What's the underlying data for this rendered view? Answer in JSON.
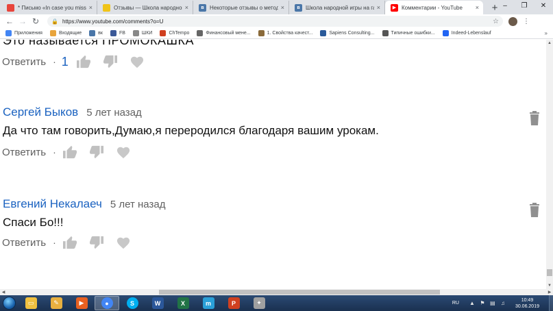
{
  "tabs": [
    {
      "title": "* Письмо «In case you missed it»",
      "icon": "mail-icon",
      "color": "#e8453c",
      "active": false
    },
    {
      "title": "Отзывы — Школа народной игры",
      "icon": "tab-page-icon",
      "color": "#f0c419",
      "active": false
    },
    {
      "title": "Некоторые отзывы о методике",
      "icon": "vk-icon",
      "color": "#4a76a8",
      "active": false
    },
    {
      "title": "Школа народной игры на гармони",
      "icon": "vk-icon",
      "color": "#4a76a8",
      "active": false
    },
    {
      "title": "Комментарии - YouTube",
      "icon": "youtube-icon",
      "color": "#ff0000",
      "active": true
    }
  ],
  "address": {
    "url": "https://www.youtube.com/comments?o=U"
  },
  "bookmarks": [
    {
      "label": "Приложения",
      "icon": "apps-icon",
      "color": "#4285f4"
    },
    {
      "label": "Входящие",
      "icon": "mail-icon",
      "color": "#e8a43c"
    },
    {
      "label": "вк",
      "icon": "vk-icon",
      "color": "#4a76a8"
    },
    {
      "label": "FB",
      "icon": "facebook-icon",
      "color": "#3b5998"
    },
    {
      "label": "ШКИ",
      "icon": "page-icon",
      "color": "#888888"
    },
    {
      "label": "ChTempo",
      "icon": "chtempo-icon",
      "color": "#d04020"
    },
    {
      "label": "Финансовый мене...",
      "icon": "page-icon",
      "color": "#666666"
    },
    {
      "label": "1. Свойства качест...",
      "icon": "page-icon",
      "color": "#8a6a3a"
    },
    {
      "label": "Sapiens Consulting...",
      "icon": "page-icon",
      "color": "#2a5a9a"
    },
    {
      "label": "Типичные ошибки...",
      "icon": "page-icon",
      "color": "#555555"
    },
    {
      "label": "Indeed-Lebenslauf",
      "icon": "page-icon",
      "color": "#2164f3"
    }
  ],
  "partial_comment": {
    "text": "Это называется ПРОМОКАШКА",
    "reply": "Ответить",
    "likes": "1"
  },
  "comments": [
    {
      "author": "Сергей Быков",
      "time": "5 лет назад",
      "text": "Да что там говорить,Думаю,я переродился благодаря вашим урокам.",
      "reply": "Ответить"
    },
    {
      "author": "Евгений Некалаеч",
      "time": "5 лет назад",
      "text": "Спаси Бо!!!",
      "reply": "Ответить"
    }
  ],
  "taskbar": {
    "apps": [
      {
        "icon": "folder-icon",
        "color": "#f0c040"
      },
      {
        "icon": "paint-icon",
        "color": "#e8b040"
      },
      {
        "icon": "media-player-icon",
        "color": "#e86020"
      },
      {
        "icon": "chrome-icon",
        "color": "#4285f4",
        "active": true
      },
      {
        "icon": "skype-icon",
        "color": "#00aff0"
      },
      {
        "icon": "word-icon",
        "color": "#2b579a"
      },
      {
        "icon": "excel-icon",
        "color": "#217346"
      },
      {
        "icon": "app-icon",
        "color": "#2aa0d8"
      },
      {
        "icon": "presentation-icon",
        "color": "#d04020"
      },
      {
        "icon": "tool-icon",
        "color": "#a0a0a0"
      }
    ],
    "lang": "RU",
    "time": "10:49",
    "date": "30.06.2019"
  }
}
